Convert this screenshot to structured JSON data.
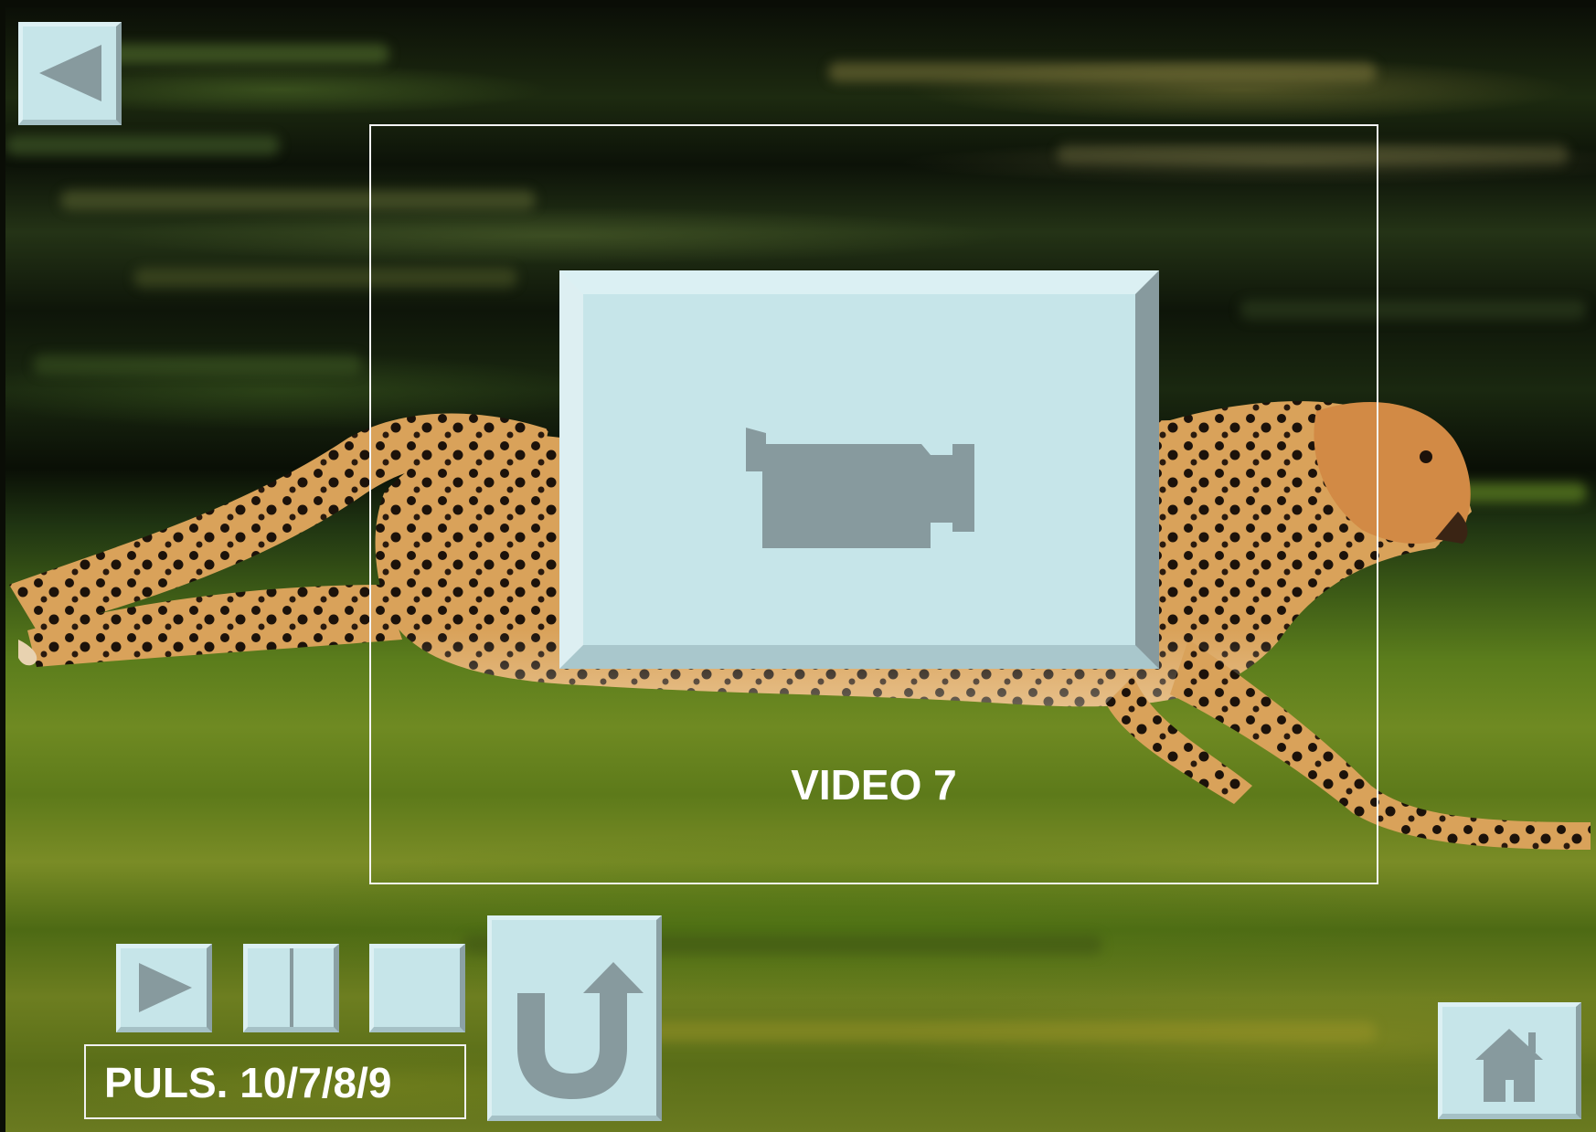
{
  "slide": {
    "video_label": "VIDEO 7",
    "pulse_label": "PULS. 10/7/8/9"
  },
  "icons": {
    "back": "triangle-left-icon",
    "video": "video-camera-icon",
    "play": "play-icon",
    "pause": "pause-icon",
    "stop": "stop-icon",
    "return": "return-arrow-icon",
    "home": "home-icon"
  },
  "colors": {
    "button_face": "#c6e5e9",
    "button_icon": "#879a9e",
    "text": "#ffffff"
  }
}
